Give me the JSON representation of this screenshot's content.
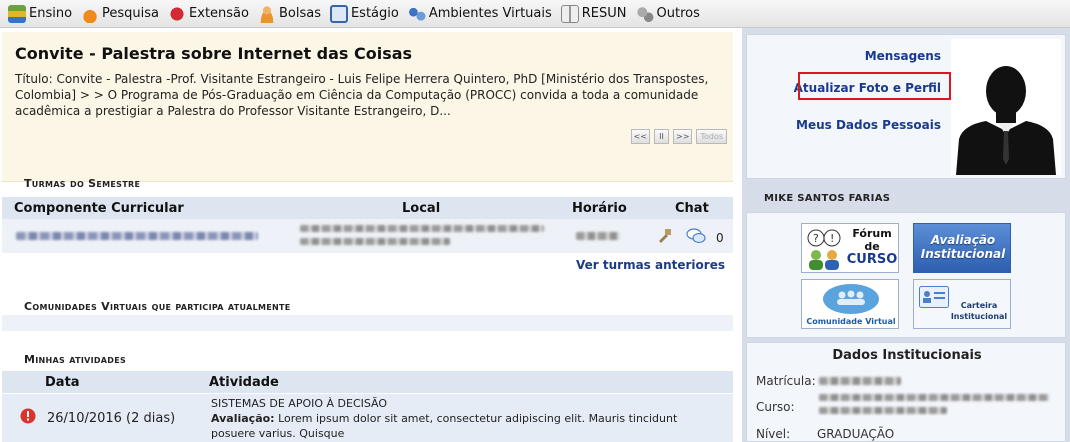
{
  "menu": [
    {
      "label": "Ensino",
      "icon": "books-icon",
      "color": "#4b8b2a"
    },
    {
      "label": "Pesquisa",
      "icon": "flask-icon",
      "color": "#e07a16"
    },
    {
      "label": "Extensão",
      "icon": "heart-gift-icon",
      "color": "#c8232c"
    },
    {
      "label": "Bolsas",
      "icon": "person-icon",
      "color": "#e8962a"
    },
    {
      "label": "Estágio",
      "icon": "id-card-icon",
      "color": "#3566a8"
    },
    {
      "label": "Ambientes Virtuais",
      "icon": "network-icon",
      "color": "#3e72c4"
    },
    {
      "label": "RESUN",
      "icon": "book-open-icon",
      "color": "#8f8f8f"
    },
    {
      "label": "Outros",
      "icon": "cogs-icon",
      "color": "#9a9a9a"
    }
  ],
  "notice": {
    "title": "Convite - Palestra sobre Internet das Coisas",
    "body": "Título: Convite - Palestra -Prof. Visitante Estrangeiro - Luis Felipe Herrera Quintero, PhD [Ministério dos Transpostes, Colombia] > > O Programa de Pós-Graduação em Ciência da Computação (PROCC) convida a toda a comunidade acadêmica a prestigiar a Palestra do Professor Visitante Estrangeiro, D...",
    "pager": [
      "<<",
      "II",
      ">>",
      "Todos"
    ]
  },
  "turmas": {
    "section_title": "Turmas do Semestre",
    "headers": {
      "componente": "Componente Curricular",
      "local": "Local",
      "horario": "Horário",
      "chat": "Chat"
    },
    "chat_count": "0",
    "older_link": "Ver turmas anteriores"
  },
  "comunidades": {
    "section_title": "Comunidades Virtuais que participa atualmente"
  },
  "atividades": {
    "section_title": "Minhas atividades",
    "headers": {
      "data": "Data",
      "atividade": "Atividade"
    },
    "rows": [
      {
        "date": "26/10/2016 (2 dias)",
        "course": "SISTEMAS DE APOIO À DECISÃO",
        "type_label": "Avaliação:",
        "description": "Lorem ipsum dolor sit amet, consectetur adipiscing elit. Mauris tincidunt posuere varius. Quisque"
      }
    ]
  },
  "profile": {
    "links": [
      "Mensagens",
      "Atualizar Foto e Perfil",
      "Meus Dados Pessoais"
    ],
    "name": "MIKE SANTOS FARIAS"
  },
  "shortcuts": {
    "forum": {
      "line1": "Fórum",
      "line2": "de",
      "line3": "CURSO"
    },
    "avaliacao": {
      "line1": "Avaliação",
      "line2": "Institucional"
    },
    "comunidade": {
      "label": "Comunidade Virtual"
    },
    "carteira": {
      "line1": "Carteira",
      "line2": "Institucional"
    }
  },
  "institucional": {
    "title": "Dados Institucionais",
    "labels": {
      "matricula": "Matrícula:",
      "curso": "Curso:",
      "nivel": "Nível:"
    },
    "nivel_value": "GRADUAÇÃO"
  }
}
